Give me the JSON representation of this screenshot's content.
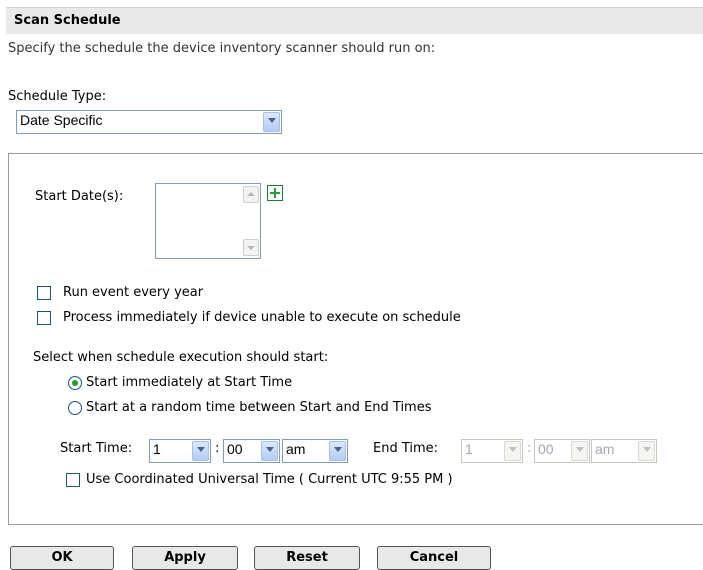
{
  "header": {
    "title": "Scan Schedule"
  },
  "description": "Specify the schedule the device inventory scanner should run on:",
  "schedule_type": {
    "label": "Schedule Type:",
    "value": "Date Specific"
  },
  "start_dates": {
    "label": "Start Date(s):"
  },
  "checkboxes": {
    "run_every_year": "Run event every year",
    "process_immediately": "Process immediately if device unable to execute on schedule",
    "use_utc": "Use Coordinated Universal Time ( Current UTC 9:55 PM )"
  },
  "execution": {
    "label": "Select when schedule execution should start:",
    "option_immediate": "Start immediately at Start Time",
    "option_random": "Start at a random time between Start and End Times",
    "selected": "option_immediate"
  },
  "start_time": {
    "label": "Start Time:",
    "hour": "1",
    "minute": "00",
    "ampm": "am"
  },
  "end_time": {
    "label": "End Time:",
    "hour": "1",
    "minute": "00",
    "ampm": "am"
  },
  "separator": ":",
  "buttons": {
    "ok": "OK",
    "apply": "Apply",
    "reset": "Reset",
    "cancel": "Cancel"
  },
  "colors": {
    "header_bg": "#e9e9e9",
    "radio_dot": "#21a121",
    "input_border": "#7f9db9"
  },
  "icons": {
    "add": "plus-icon",
    "dropdown": "chevron-down-icon"
  }
}
